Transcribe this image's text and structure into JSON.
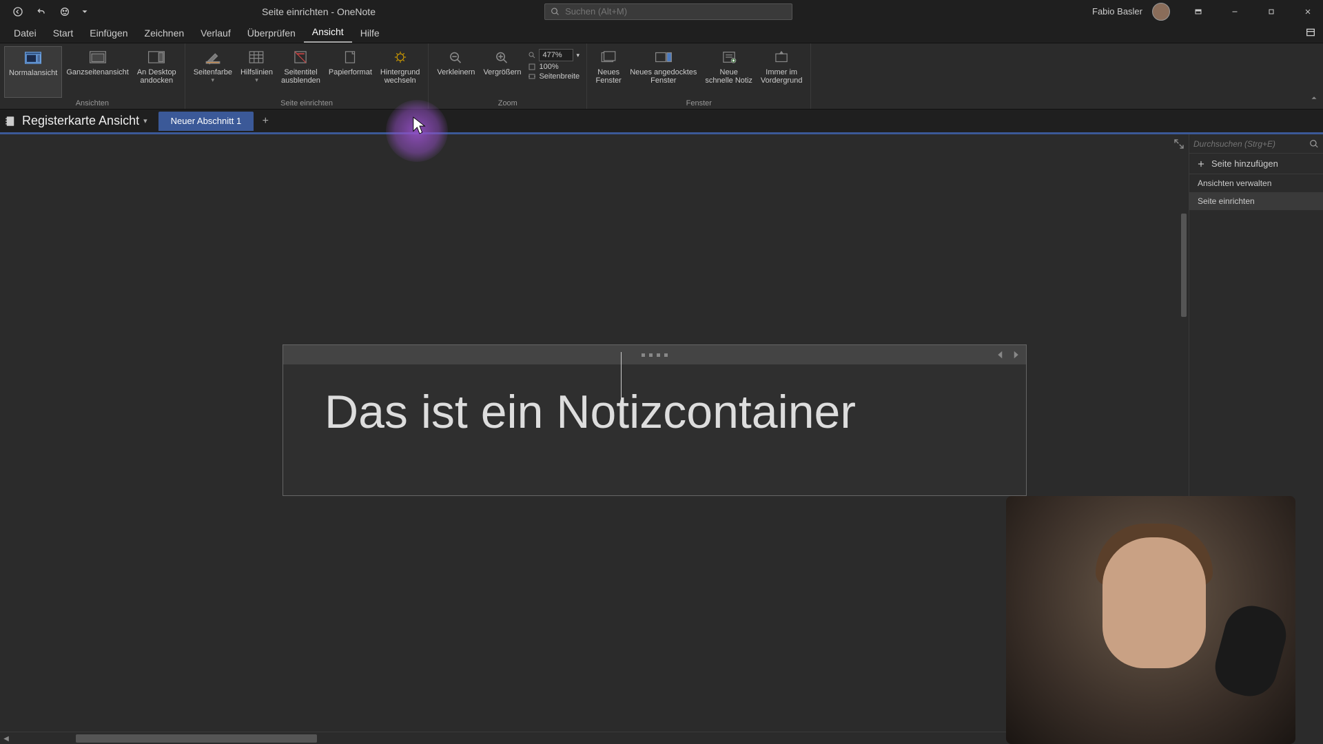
{
  "titlebar": {
    "title": "Seite einrichten  -  OneNote",
    "search_placeholder": "Suchen (Alt+M)",
    "username": "Fabio Basler"
  },
  "menu": {
    "items": [
      "Datei",
      "Start",
      "Einfügen",
      "Zeichnen",
      "Verlauf",
      "Überprüfen",
      "Ansicht",
      "Hilfe"
    ],
    "active": "Ansicht"
  },
  "ribbon": {
    "groups": [
      {
        "caption": "Ansichten",
        "buttons": [
          {
            "label": "Normalansicht",
            "name": "normalansicht",
            "active": true
          },
          {
            "label": "Ganzseitenansicht",
            "name": "ganzseitenansicht"
          },
          {
            "label": "An Desktop\nandocken",
            "name": "an-desktop-andocken"
          }
        ]
      },
      {
        "caption": "Seite einrichten",
        "buttons": [
          {
            "label": "Seitenfarbe",
            "name": "seitenfarbe",
            "dropdown": true
          },
          {
            "label": "Hilfslinien",
            "name": "hilfslinien",
            "dropdown": true
          },
          {
            "label": "Seitentitel\nausblenden",
            "name": "seitentitel-ausblenden"
          },
          {
            "label": "Papierformat",
            "name": "papierformat"
          },
          {
            "label": "Hintergrund\nwechseln",
            "name": "hintergrund-wechseln"
          }
        ]
      },
      {
        "caption": "Zoom",
        "buttons": [
          {
            "label": "Verkleinern",
            "name": "verkleinern"
          },
          {
            "label": "Vergrößern",
            "name": "vergroessern"
          }
        ],
        "extra": {
          "zoom_value": "477%",
          "hundred": "100%",
          "pagewidth": "Seitenbreite"
        }
      },
      {
        "caption": "Fenster",
        "buttons": [
          {
            "label": "Neues\nFenster",
            "name": "neues-fenster"
          },
          {
            "label": "Neues angedocktes\nFenster",
            "name": "neues-angedocktes-fenster"
          },
          {
            "label": "Neue\nschnelle Notiz",
            "name": "neue-schnelle-notiz"
          },
          {
            "label": "Immer im\nVordergrund",
            "name": "immer-im-vordergrund"
          }
        ]
      }
    ]
  },
  "notebook": {
    "name": "Registerkarte Ansicht",
    "section": "Neuer Abschnitt 1"
  },
  "note": {
    "text": "Das ist ein Notizcontainer"
  },
  "rightpanel": {
    "search_placeholder": "Durchsuchen (Strg+E)",
    "add_page": "Seite hinzufügen",
    "items": [
      {
        "label": "Ansichten verwalten",
        "sel": false
      },
      {
        "label": "Seite einrichten",
        "sel": true
      }
    ]
  }
}
